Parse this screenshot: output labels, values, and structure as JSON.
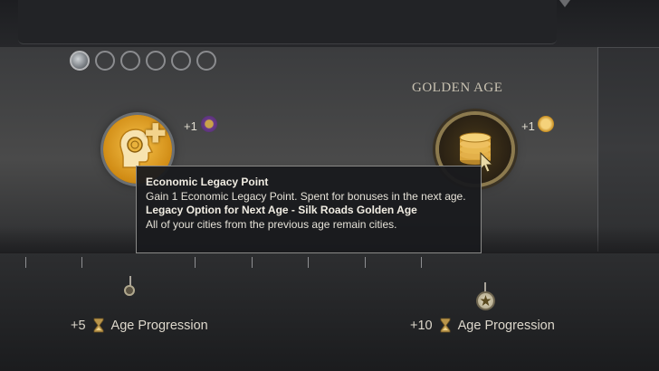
{
  "progress_pips": {
    "total": 6,
    "filled": 1
  },
  "golden_age": {
    "title": "GOLDEN AGE"
  },
  "left_reward": {
    "amount": "+1",
    "icon": "economic-legacy-icon"
  },
  "right_reward": {
    "amount": "+1",
    "icon": "golden-age-legacy-icon"
  },
  "tooltip": {
    "line1_title": "Economic Legacy Point",
    "line1_body": "Gain 1 Economic Legacy Point. Spent for bonuses in the next age.",
    "line2_title": "Legacy Option for Next Age - Silk Roads Golden Age",
    "line2_body": "All of your cities from the previous age remain cities."
  },
  "milestones": [
    {
      "amount": "+5",
      "label": "Age Progression"
    },
    {
      "amount": "+10",
      "label": "Age Progression"
    }
  ],
  "colors": {
    "gold": "#d8a23a",
    "accent": "#e8c86a",
    "panel": "#3b3c3e"
  }
}
